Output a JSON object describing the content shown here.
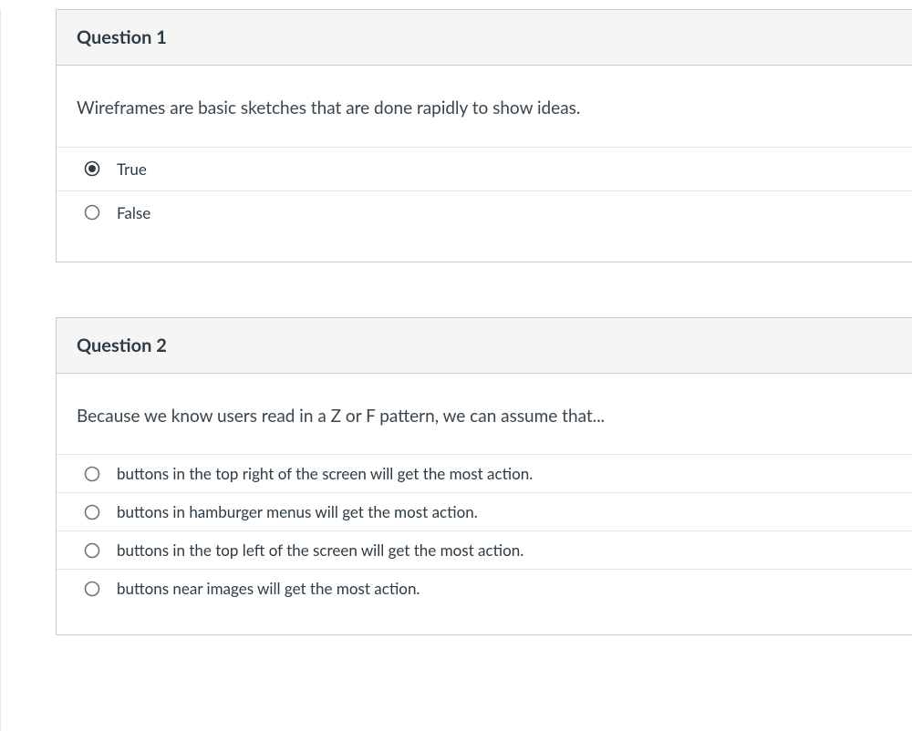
{
  "questions": [
    {
      "title": "Question 1",
      "prompt": "Wireframes are basic sketches that are done rapidly to show ideas.",
      "options": [
        {
          "label": "True",
          "selected": true
        },
        {
          "label": "False",
          "selected": false
        }
      ]
    },
    {
      "title": "Question 2",
      "prompt": "Because we know users read in a Z or F pattern, we can assume that...",
      "options": [
        {
          "label": "buttons in the top right of the screen will get the most action.",
          "selected": false
        },
        {
          "label": "buttons in hamburger menus will get the most action.",
          "selected": false
        },
        {
          "label": "buttons in the top left of the screen will get the most action.",
          "selected": false
        },
        {
          "label": "buttons near images will get the most action.",
          "selected": false
        }
      ]
    }
  ]
}
